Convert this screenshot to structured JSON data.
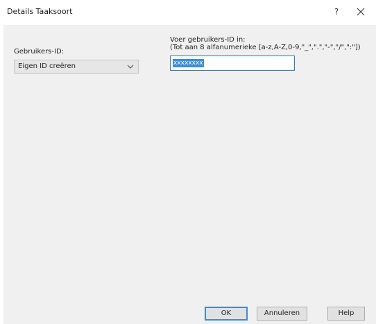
{
  "window": {
    "title": "Details Taaksoort",
    "help_glyph": "?",
    "close_icon": "close-icon"
  },
  "form": {
    "user_id_label": "Gebruikers-ID:",
    "user_id_select_value": "Eigen ID creëren",
    "enter_id_label_line1": "Voer gebruikers-ID in:",
    "enter_id_label_line2": "(Tot aan 8 alfanumerieke [a-z,A-Z,0-9,\"_\",\".\",\"-\",\"/\",\":\"])",
    "id_input_value": "xxxxxxxx"
  },
  "buttons": {
    "ok": "OK",
    "cancel": "Annuleren",
    "help": "Help"
  },
  "colors": {
    "accent": "#3b8de0",
    "panel": "#f0f0f0"
  }
}
